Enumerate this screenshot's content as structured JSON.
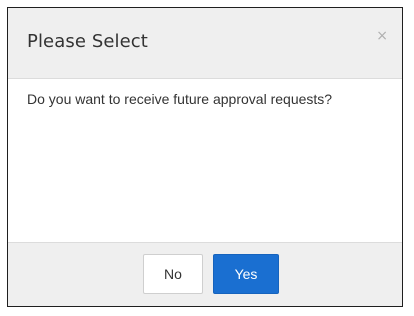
{
  "dialog": {
    "title": "Please Select",
    "close_icon": "×",
    "message": "Do you want to receive future approval requests?",
    "buttons": {
      "no_label": "No",
      "yes_label": "Yes"
    }
  },
  "colors": {
    "primary": "#1a6fd1",
    "header_bg": "#efefef",
    "text": "#333333"
  }
}
